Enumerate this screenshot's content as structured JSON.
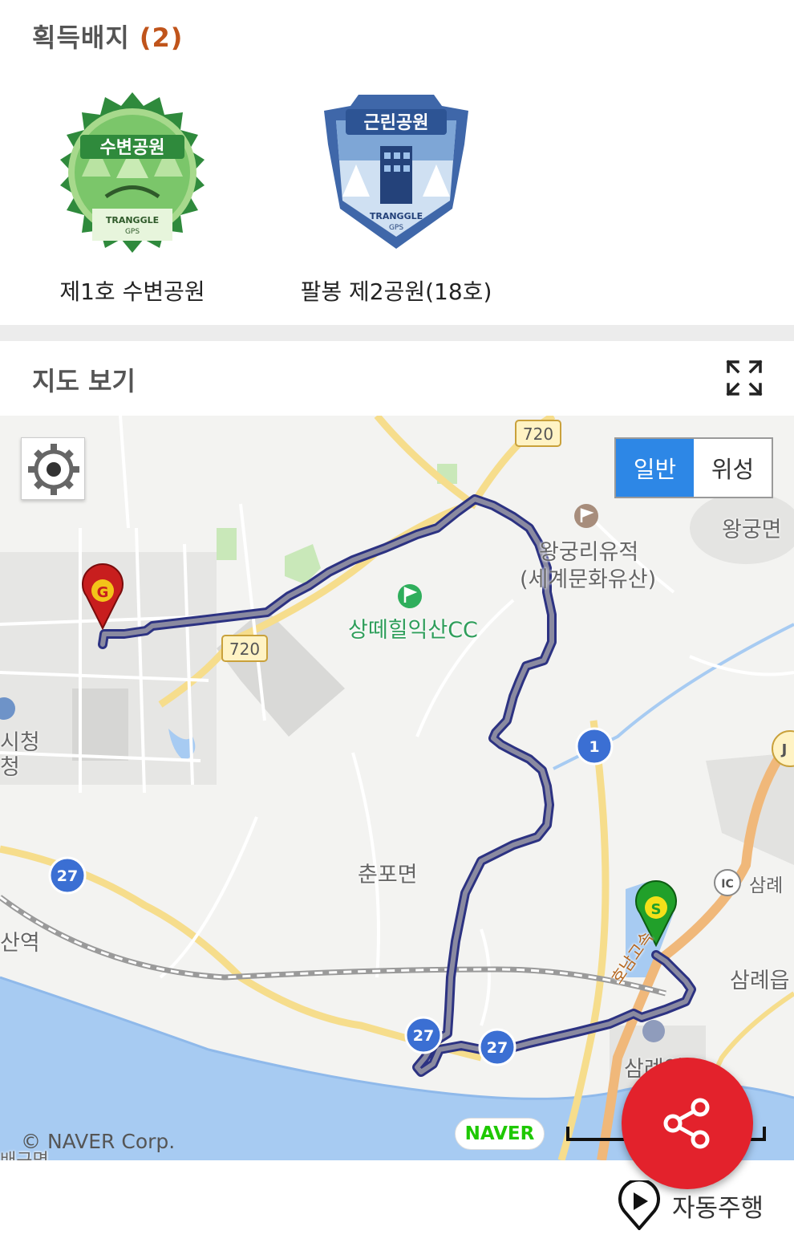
{
  "badges": {
    "title": "획득배지",
    "count": "(2)",
    "items": [
      {
        "name": "제1호 수변공원",
        "ribbon": "수변공원",
        "brand": "TRANGGLE",
        "brand_sub": "GPS",
        "color": "#3a9b46"
      },
      {
        "name": "팔봉 제2공원(18호)",
        "ribbon": "근린공원",
        "brand": "TRANGGLE",
        "brand_sub": "GPS",
        "color": "#3f67a9"
      }
    ]
  },
  "map": {
    "title": "지도 보기",
    "map_type": {
      "normal": "일반",
      "satellite": "위성",
      "selected": "normal"
    },
    "labels": {
      "golf": "상떼힐익산CC",
      "heritage_1": "왕궁리유적",
      "heritage_2": "(세계문화유산)",
      "wanggung": "왕궁면",
      "chunpo": "춘포면",
      "city_hall_1": "시청",
      "city_hall_2": "청",
      "station": "산역",
      "samnye_ic": "삼례",
      "samnye": "삼례읍",
      "samnye_station": "삼례역",
      "expressway": "호남고속",
      "bottom_cut": "배구면"
    },
    "road_shields": [
      "720",
      "720",
      "1",
      "27",
      "27",
      "27",
      "IC",
      "J"
    ],
    "markers": {
      "start": "S",
      "goal": "G"
    },
    "copyright": "© NAVER Corp.",
    "logo": "NAVER",
    "route_color": "#2c3282"
  },
  "actions": {
    "autoplay_label": "자동주행"
  }
}
